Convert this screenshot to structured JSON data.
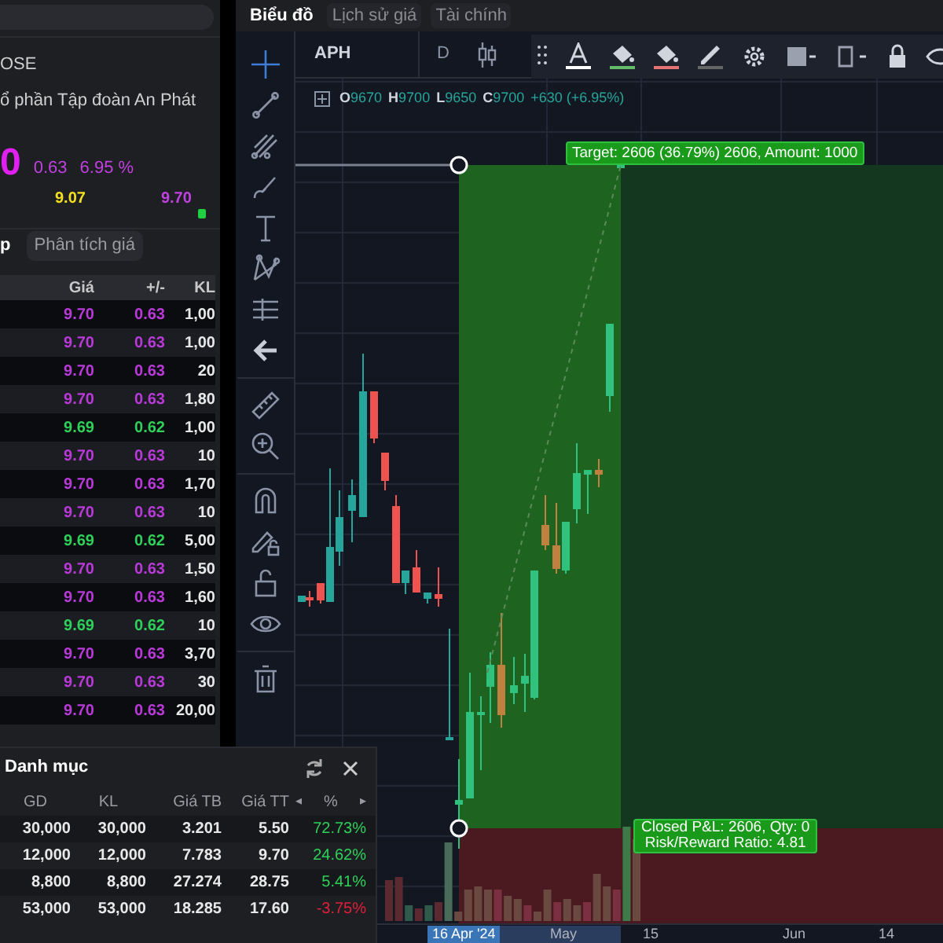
{
  "left_panel": {
    "exchange": "OSE",
    "company": "ổ phần Tập đoàn An Phát",
    "price": "0",
    "change": "0.63",
    "change_pct": "6.95 %",
    "ref_price": "9.07",
    "ceiling_price": "9.70",
    "tabs": [
      {
        "label": "p",
        "selected": true
      },
      {
        "label": "Phân tích giá",
        "selected": false
      }
    ],
    "trades": {
      "columns": [
        "Giá",
        "+/-",
        "KL"
      ],
      "rows": [
        {
          "price": "9.70",
          "change": "0.63",
          "volume": "1,00",
          "color": "#b93ad8"
        },
        {
          "price": "9.70",
          "change": "0.63",
          "volume": "1,00",
          "color": "#b93ad8"
        },
        {
          "price": "9.70",
          "change": "0.63",
          "volume": "20",
          "color": "#b93ad8"
        },
        {
          "price": "9.70",
          "change": "0.63",
          "volume": "1,80",
          "color": "#b93ad8"
        },
        {
          "price": "9.69",
          "change": "0.62",
          "volume": "1,00",
          "color": "#2ed05a"
        },
        {
          "price": "9.70",
          "change": "0.63",
          "volume": "10",
          "color": "#b93ad8"
        },
        {
          "price": "9.70",
          "change": "0.63",
          "volume": "1,70",
          "color": "#b93ad8"
        },
        {
          "price": "9.70",
          "change": "0.63",
          "volume": "10",
          "color": "#b93ad8"
        },
        {
          "price": "9.69",
          "change": "0.62",
          "volume": "5,00",
          "color": "#2ed05a"
        },
        {
          "price": "9.70",
          "change": "0.63",
          "volume": "1,50",
          "color": "#b93ad8"
        },
        {
          "price": "9.70",
          "change": "0.63",
          "volume": "1,60",
          "color": "#b93ad8"
        },
        {
          "price": "9.69",
          "change": "0.62",
          "volume": "10",
          "color": "#2ed05a"
        },
        {
          "price": "9.70",
          "change": "0.63",
          "volume": "3,70",
          "color": "#b93ad8"
        },
        {
          "price": "9.70",
          "change": "0.63",
          "volume": "30",
          "color": "#b93ad8"
        },
        {
          "price": "9.70",
          "change": "0.63",
          "volume": "20,00",
          "color": "#b93ad8"
        }
      ]
    }
  },
  "portfolio": {
    "title": "Danh mục",
    "columns": [
      "GD",
      "KL",
      "Giá TB",
      "Giá TT",
      "%"
    ],
    "scroll_left": "◂",
    "scroll_right": "▸",
    "rows": [
      {
        "cells": [
          "30,000",
          "30,000",
          "3.201",
          "5.50",
          "72.73%"
        ],
        "color": "#2ed05a"
      },
      {
        "cells": [
          "12,000",
          "12,000",
          "7.783",
          "9.70",
          "24.62%"
        ],
        "color": "#2ed05a"
      },
      {
        "cells": [
          "8,800",
          "8,800",
          "27.274",
          "28.75",
          "5.41%"
        ],
        "color": "#2ed05a"
      },
      {
        "cells": [
          "53,000",
          "53,000",
          "18.285",
          "17.60",
          "-3.75%"
        ],
        "color": "#e0203a"
      }
    ]
  },
  "chart_panel": {
    "tabs": [
      {
        "label": "Biểu đồ",
        "selected": true
      },
      {
        "label": "Lịch sử giá",
        "selected": false
      },
      {
        "label": "Tài chính",
        "selected": false
      }
    ],
    "symbol": "APH",
    "interval": "D",
    "legend": [
      {
        "key": "O",
        "value": "9670"
      },
      {
        "key": "H",
        "value": "9700"
      },
      {
        "key": "L",
        "value": "9650"
      },
      {
        "key": "C",
        "value": "9700"
      }
    ],
    "legend_change": "+630 (+6.95%)",
    "target_label": "Target: 2606 (36.79%) 2606, Amount: 1000",
    "result_label": [
      "Closed P&L: 2606, Qty: 0",
      "Risk/Reward Ratio: 4.81"
    ],
    "x_axis": [
      {
        "label": "16 Apr '24",
        "selected": true
      },
      {
        "label": "May",
        "selected": false
      },
      {
        "label": "15",
        "selected": false
      },
      {
        "label": "Jun",
        "selected": false
      },
      {
        "label": "14",
        "selected": false
      }
    ]
  }
}
